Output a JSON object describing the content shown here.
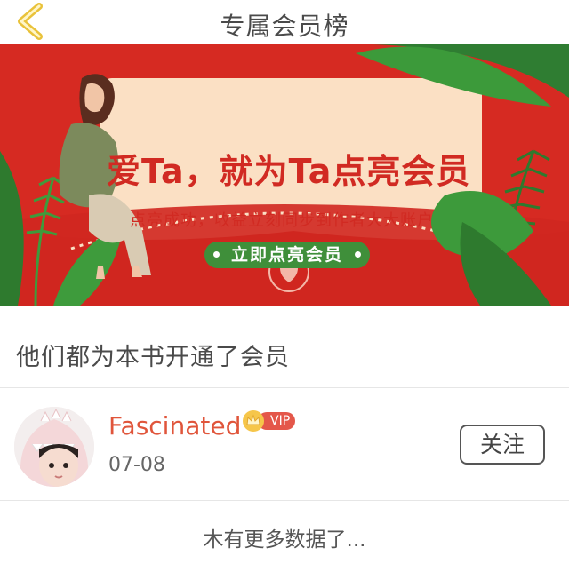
{
  "header": {
    "title": "专属会员榜",
    "back_icon": "chevron-left-icon",
    "back_color": "#e9c23a"
  },
  "banner": {
    "headline": "爱Ta，就为Ta点亮会员",
    "subtitle": "点亮成功，收益立刻同步到作者大大账户",
    "cta_label": "立即点亮会员",
    "colors": {
      "background": "#d62a22",
      "card": "#fbe0c4",
      "cta": "#3f8f3a",
      "text": "#d12a22"
    }
  },
  "section": {
    "title": "他们都为本书开通了会员"
  },
  "members": [
    {
      "name": "Fascinated",
      "badge": "VIP",
      "date": "07-08",
      "follow_label": "关注",
      "avatar_icon": "user-avatar"
    }
  ],
  "footer": {
    "no_more_text": "木有更多数据了..."
  }
}
